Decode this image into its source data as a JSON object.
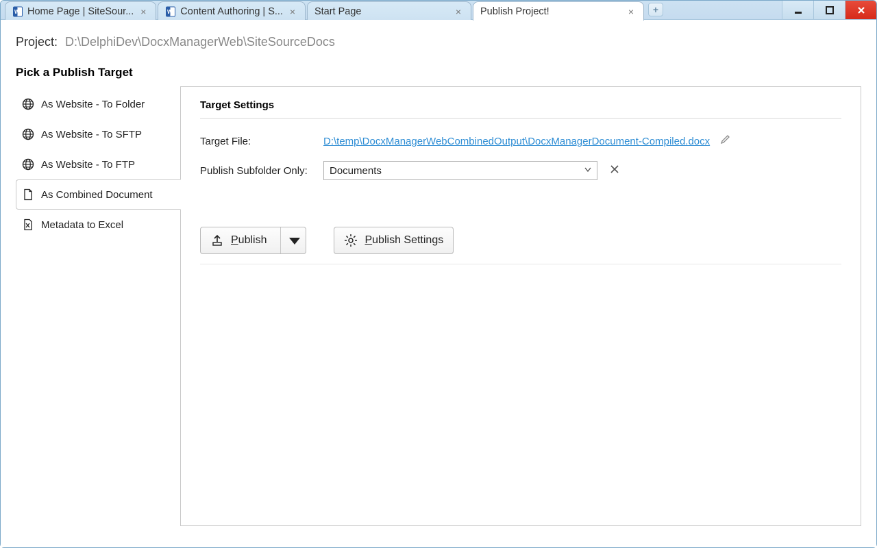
{
  "tabs": [
    {
      "label": "Home Page | SiteSour...",
      "icon": "word",
      "has_close": true
    },
    {
      "label": "Content Authoring | S...",
      "icon": "word",
      "has_close": true
    },
    {
      "label": "Start Page",
      "icon": null,
      "has_close": true
    },
    {
      "label": "Publish Project!",
      "icon": null,
      "has_close": true,
      "active": true
    }
  ],
  "project": {
    "label": "Project:",
    "path": "D:\\DelphiDev\\DocxManagerWeb\\SiteSourceDocs"
  },
  "pick_heading": "Pick a Publish Target",
  "targets": [
    {
      "label": "As Website - To Folder",
      "icon": "globe"
    },
    {
      "label": "As Website - To SFTP",
      "icon": "globe"
    },
    {
      "label": "As Website - To FTP",
      "icon": "globe"
    },
    {
      "label": "As Combined Document",
      "icon": "document",
      "selected": true
    },
    {
      "label": "Metadata to Excel",
      "icon": "excel"
    }
  ],
  "settings": {
    "heading": "Target Settings",
    "target_file_label": "Target File:",
    "target_file_value": "D:\\temp\\DocxManagerWebCombinedOutput\\DocxManagerDocument-Compiled.docx",
    "subfolder_label": "Publish Subfolder Only:",
    "subfolder_value": "Documents"
  },
  "buttons": {
    "publish": "Publish",
    "publish_settings": "Publish Settings"
  }
}
